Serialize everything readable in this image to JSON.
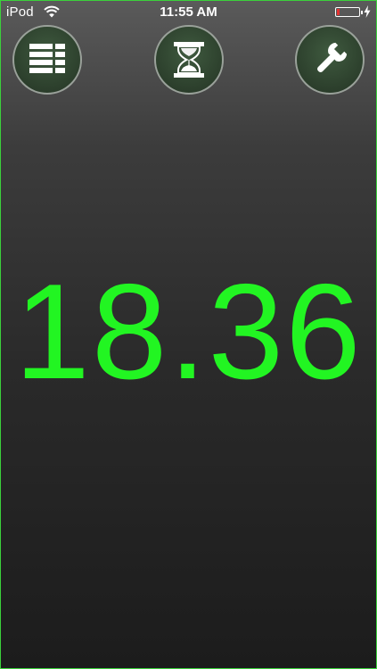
{
  "status_bar": {
    "carrier": "iPod",
    "time": "11:55 AM",
    "battery_level": 0.12,
    "wifi_icon": "wifi-icon",
    "battery_icon": "battery-icon",
    "charging_icon": "charging-bolt-icon"
  },
  "toolbar": {
    "left_icon": "list-icon",
    "center_icon": "hourglass-icon",
    "right_icon": "wrench-icon"
  },
  "timer": {
    "value": "18.36"
  },
  "colors": {
    "readout": "#22f522",
    "button_fill": "#2c3f2c",
    "battery_low": "#e33232"
  }
}
